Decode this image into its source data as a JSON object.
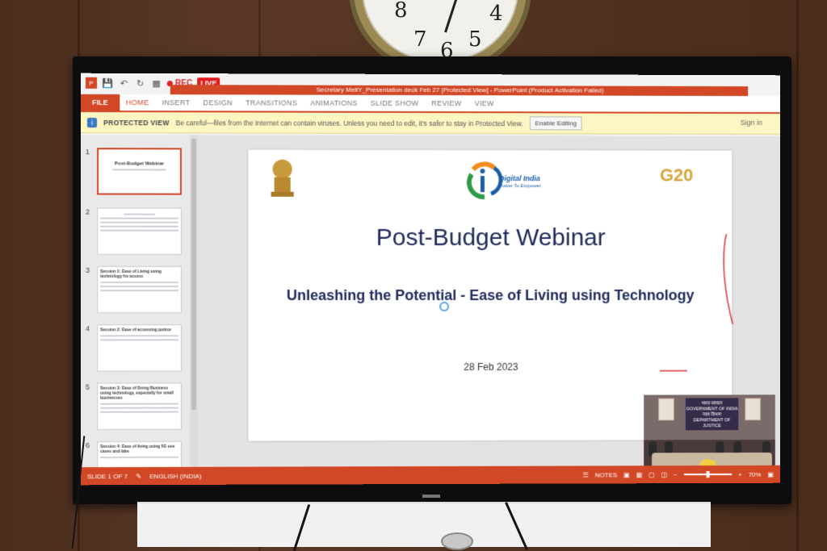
{
  "clock": {
    "numerals": [
      "8",
      "7",
      "6",
      "5",
      "4"
    ]
  },
  "recorder": {
    "rec_label": "REC",
    "live_label": "LIVE"
  },
  "window": {
    "title": "Secretary MeitY_Presentation deck Feb 27 [Protected View] - PowerPoint (Product Activation Failed)",
    "sign_in": "Sign in"
  },
  "ribbon": {
    "tabs": [
      "FILE",
      "HOME",
      "INSERT",
      "DESIGN",
      "TRANSITIONS",
      "ANIMATIONS",
      "SLIDE SHOW",
      "REVIEW",
      "VIEW"
    ]
  },
  "protected_view": {
    "title": "PROTECTED VIEW",
    "message": "Be careful—files from the Internet can contain viruses. Unless you need to edit, it's safer to stay in Protected View.",
    "button": "Enable Editing"
  },
  "thumbnails": [
    {
      "num": "1",
      "title": "Post-Budget Webinar"
    },
    {
      "num": "2",
      "title": ""
    },
    {
      "num": "3",
      "title": "Session 1: Ease of Living using technology for access"
    },
    {
      "num": "4",
      "title": "Session 2: Ease of accessing justice"
    },
    {
      "num": "5",
      "title": "Session 3: Ease of Doing Business using technology, especially for small businesses"
    },
    {
      "num": "6",
      "title": "Session 4: Ease of living using 5G use cases and labs"
    }
  ],
  "slide": {
    "digital_india": "Digital India",
    "digital_india_sub": "Power To Empower",
    "g20": "G20",
    "title": "Post-Budget Webinar",
    "subtitle": "Unleashing the Potential - Ease of Living using Technology",
    "date": "28 Feb 2023"
  },
  "video": {
    "banner": "भारत सरकार\nGOVERNMENT OF INDIA\nन्याय विभाग\nDEPARTMENT OF JUSTICE"
  },
  "status": {
    "slide_counter": "SLIDE 1 OF 7",
    "language": "ENGLISH (INDIA)",
    "notes": "NOTES",
    "zoom": "70%"
  },
  "colors": {
    "accent": "#d24726",
    "title_navy": "#1f2a5a",
    "protected_bar": "#fdf6c3"
  }
}
